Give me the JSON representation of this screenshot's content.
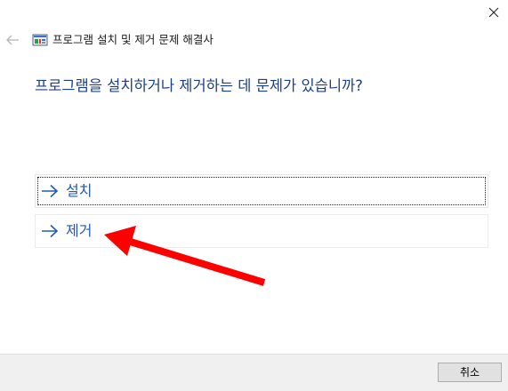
{
  "window": {
    "title": "프로그램 설치 및 제거 문제 해결사",
    "icons": {
      "close": "close-icon",
      "back": "back-arrow-icon",
      "app": "troubleshooter-icon"
    }
  },
  "main": {
    "question": "프로그램을 설치하거나 제거하는 데 문제가 있습니까?",
    "options": [
      {
        "label": "설치",
        "icon": "right-arrow-icon",
        "focused": true
      },
      {
        "label": "제거",
        "icon": "right-arrow-icon",
        "focused": false
      }
    ]
  },
  "annotation": {
    "type": "red-pointer-arrow",
    "color": "#ff0000",
    "points_to": "제거"
  },
  "footer": {
    "cancel_label": "취소"
  },
  "colors": {
    "link_blue": "#1f5ab8",
    "heading_blue": "#1b3f86",
    "footer_bg": "#f0f0f0"
  }
}
